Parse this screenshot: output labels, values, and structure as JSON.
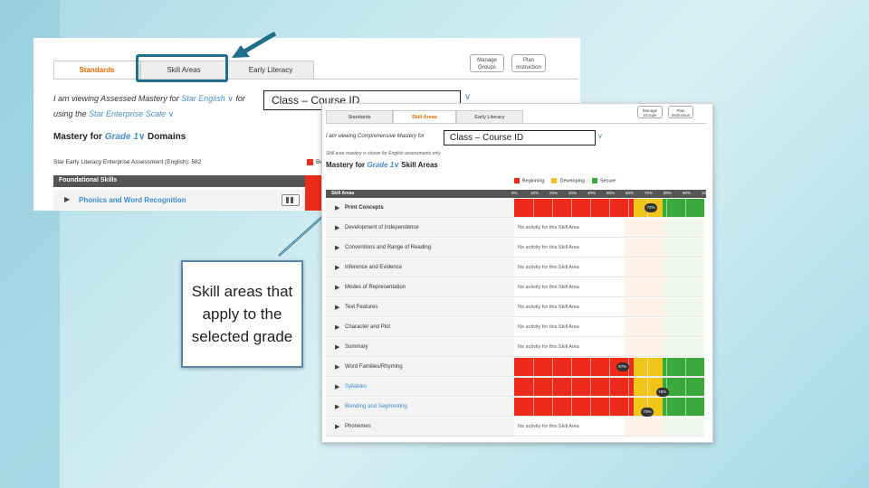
{
  "colors": {
    "red": "#ee2b1b",
    "yellow": "#f0c419",
    "green": "#3aa83a",
    "link": "#4a8fc9",
    "accent": "#e06a00",
    "annotation": "#1f6f8b"
  },
  "back": {
    "tabs": [
      {
        "label": "Standards"
      },
      {
        "label": "Skill Areas"
      },
      {
        "label": "Early Literacy"
      }
    ],
    "manage_groups": "Manage Groups",
    "plan_instruction": "Plan Instruction",
    "viewing_pre": "I am viewing Assessed Mastery for",
    "product": "Star English",
    "for_word": "for",
    "using_pre": "using the",
    "scale": "Star Enterprise Scale",
    "mastery_for": "Mastery for",
    "grade": "Grade 1",
    "domains": "Domains",
    "assessment": "Star Early Literacy Enterprise Assessment (English): 582",
    "legend_partial": "Be",
    "foundational": "Foundational Skills",
    "phonics": "Phonics and Word Recognition"
  },
  "class_id": "Class – Course ID",
  "front": {
    "tabs": [
      {
        "label": "Standards"
      },
      {
        "label": "Skill Areas"
      },
      {
        "label": "Early Literacy"
      }
    ],
    "manage_groups": "Manage Groups",
    "plan_instruction": "Plan Instruction",
    "viewing": "I am viewing Comprehensive Mastery for",
    "note": "Skill area mastery is shown for English assessments only.",
    "mastery_for": "Mastery for",
    "grade": "Grade 1",
    "skill_areas": "Skill Areas",
    "legend": [
      {
        "label": "Beginning",
        "color": "#ee2b1b"
      },
      {
        "label": "Developing",
        "color": "#f0c419"
      },
      {
        "label": "Secure",
        "color": "#3aa83a"
      }
    ],
    "col_header": "Skill Areas",
    "scale": [
      "0%",
      "10%",
      "20%",
      "30%",
      "40%",
      "50%",
      "60%",
      "70%",
      "80%",
      "90%",
      "100%"
    ],
    "no_activity": "No activity for this Skill Area",
    "rows": [
      {
        "name": "Print Concepts",
        "pct": 72,
        "active": true,
        "link": false,
        "bold": true
      },
      {
        "name": "Development of Independence",
        "active": false,
        "link": false
      },
      {
        "name": "Conventions and Range of Reading",
        "active": false,
        "link": false
      },
      {
        "name": "Inference and Evidence",
        "active": false,
        "link": false
      },
      {
        "name": "Modes of Representation",
        "active": false,
        "link": false
      },
      {
        "name": "Text Features",
        "active": false,
        "link": false
      },
      {
        "name": "Character and Plot",
        "active": false,
        "link": false
      },
      {
        "name": "Summary",
        "active": false,
        "link": false
      },
      {
        "name": "Word Families/Rhyming",
        "pct": 57,
        "active": true,
        "link": false
      },
      {
        "name": "Syllables",
        "pct": 78,
        "active": true,
        "link": true
      },
      {
        "name": "Blending and Segmenting",
        "pct": 70,
        "active": true,
        "link": true
      },
      {
        "name": "Phonemes",
        "active": false,
        "link": false
      }
    ]
  },
  "callout": "Skill areas that apply to the selected grade"
}
